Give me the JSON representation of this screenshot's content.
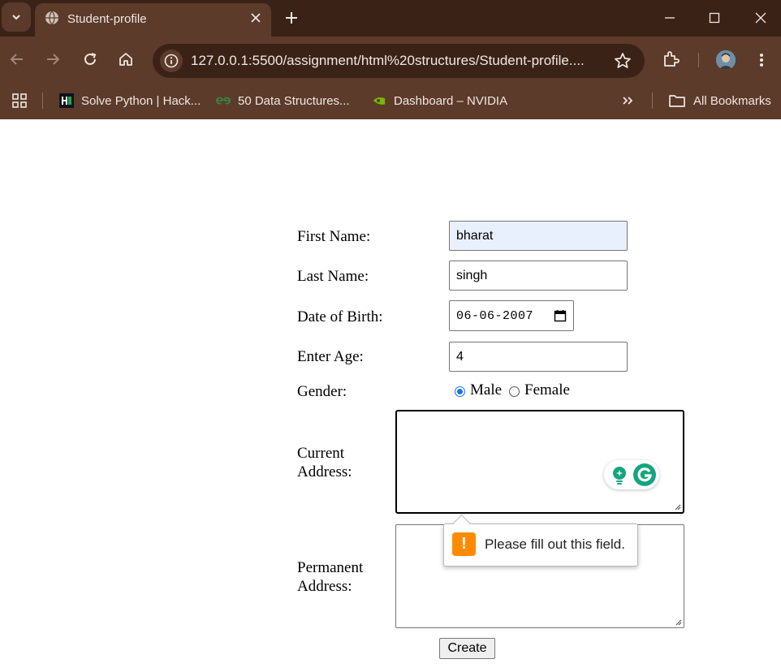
{
  "browser": {
    "tab_title": "Student-profile",
    "url": "127.0.0.1:5500/assignment/html%20structures/Student-profile....",
    "bookmarks": [
      {
        "label": "Solve Python | Hack...",
        "icon": "hackerrank-icon"
      },
      {
        "label": "50 Data Structures...",
        "icon": "geeksforgeeks-icon"
      },
      {
        "label": "Dashboard – NVIDIA",
        "icon": "nvidia-icon"
      }
    ],
    "all_bookmarks_label": "All Bookmarks"
  },
  "form": {
    "first_name": {
      "label": "First Name:",
      "value": "bharat"
    },
    "last_name": {
      "label": "Last Name:",
      "value": "singh"
    },
    "dob": {
      "label": "Date of Birth:",
      "value": "06-06-2007"
    },
    "age": {
      "label": "Enter Age:",
      "value": "4"
    },
    "gender": {
      "label": "Gender:",
      "options": [
        "Male",
        "Female"
      ],
      "selected": "Male"
    },
    "current_address": {
      "label_line1": "Current",
      "label_line2": "Address:",
      "value": ""
    },
    "permanent_address": {
      "label_line1": "Permanent",
      "label_line2": "Address:",
      "value": ""
    },
    "validation_message": "Please fill out this field.",
    "submit_label": "Create"
  },
  "colors": {
    "tabbar": "#3b2217",
    "toolbar": "#5c3b2a",
    "accent": "#1a73e8",
    "autofill": "#e8f0fe",
    "warning": "#ff8a00",
    "grammarly": "#15a57e"
  }
}
